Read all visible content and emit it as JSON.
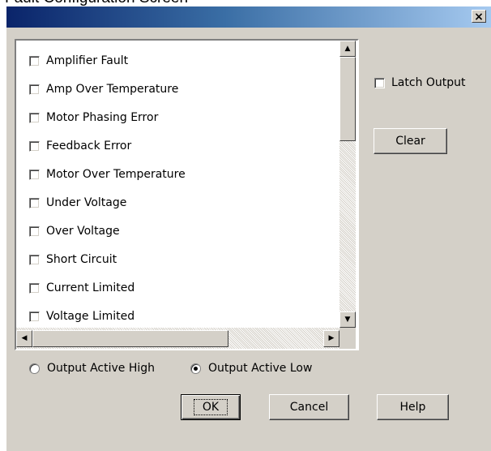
{
  "window": {
    "title": "Fault Configuration Screen",
    "close_label": "×"
  },
  "fault_list": {
    "items": [
      {
        "label": "Amplifier Fault",
        "checked": false
      },
      {
        "label": "Amp Over Temperature",
        "checked": false
      },
      {
        "label": "Motor Phasing Error",
        "checked": false
      },
      {
        "label": "Feedback Error",
        "checked": false
      },
      {
        "label": "Motor Over Temperature",
        "checked": false
      },
      {
        "label": "Under Voltage",
        "checked": false
      },
      {
        "label": "Over Voltage",
        "checked": false
      },
      {
        "label": "Short Circuit",
        "checked": false
      },
      {
        "label": "Current Limited",
        "checked": false
      },
      {
        "label": "Voltage Limited",
        "checked": false
      }
    ]
  },
  "latch_output": {
    "label": "Latch Output",
    "checked": false
  },
  "clear_button": {
    "label": "Clear"
  },
  "output_polarity": {
    "options": [
      {
        "label": "Output Active High",
        "selected": false
      },
      {
        "label": "Output Active Low",
        "selected": true
      }
    ]
  },
  "buttons": {
    "ok": "OK",
    "cancel": "Cancel",
    "help": "Help"
  },
  "icons": {
    "scroll_up": "up-arrow-icon",
    "scroll_down": "down-arrow-icon",
    "scroll_left": "left-arrow-icon",
    "scroll_right": "right-arrow-icon",
    "close": "close-icon"
  }
}
